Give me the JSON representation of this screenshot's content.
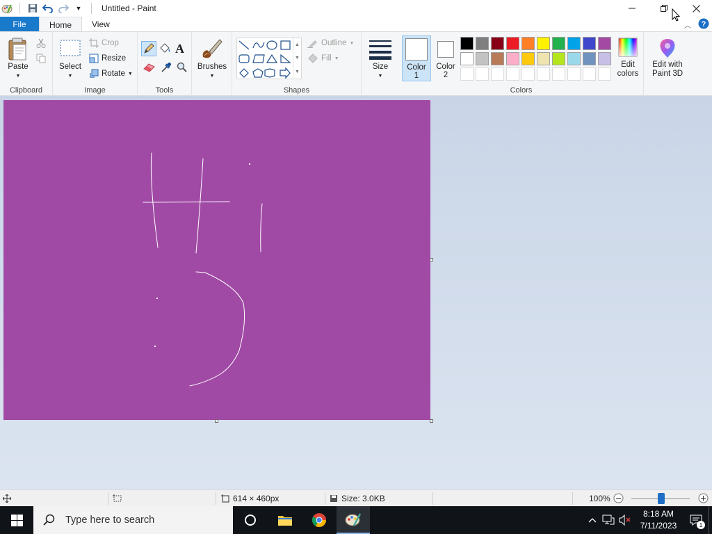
{
  "window": {
    "title": "Untitled - Paint"
  },
  "tabs": {
    "file": "File",
    "home": "Home",
    "view": "View"
  },
  "ribbon": {
    "clipboard": {
      "label": "Clipboard",
      "paste": "Paste"
    },
    "image": {
      "label": "Image",
      "select": "Select",
      "crop": "Crop",
      "resize": "Resize",
      "rotate": "Rotate"
    },
    "tools": {
      "label": "Tools"
    },
    "brushes": {
      "label": "Brushes"
    },
    "shapes": {
      "label": "Shapes",
      "outline": "Outline",
      "fill": "Fill"
    },
    "size": {
      "label": "Size"
    },
    "color1": {
      "line1": "Color",
      "line2": "1",
      "value": "#ffffff"
    },
    "color2": {
      "line1": "Color",
      "line2": "2",
      "value": "#ffffff"
    },
    "colors": {
      "label": "Colors",
      "row1": [
        "#000000",
        "#7f7f7f",
        "#880015",
        "#ed1c24",
        "#ff7f27",
        "#fff200",
        "#22b14c",
        "#00a2e8",
        "#3f48cc",
        "#a349a4"
      ],
      "row2": [
        "#ffffff",
        "#c3c3c3",
        "#b97a57",
        "#ffaec9",
        "#ffc90e",
        "#efe4b0",
        "#b5e61d",
        "#99d9ea",
        "#7092be",
        "#c8bfe7"
      ]
    },
    "edit_colors": {
      "line1": "Edit",
      "line2": "colors"
    },
    "paint3d": {
      "line1": "Edit with",
      "line2": "Paint 3D"
    }
  },
  "canvas": {
    "background": "#a04aa5",
    "stroke": "#ffffff"
  },
  "statusbar": {
    "dimensions": "614 × 460px",
    "size": "Size: 3.0KB",
    "zoom": "100%"
  },
  "taskbar": {
    "search_placeholder": "Type here to search",
    "time": "8:18 AM",
    "date": "7/11/2023",
    "notification_count": "1"
  }
}
